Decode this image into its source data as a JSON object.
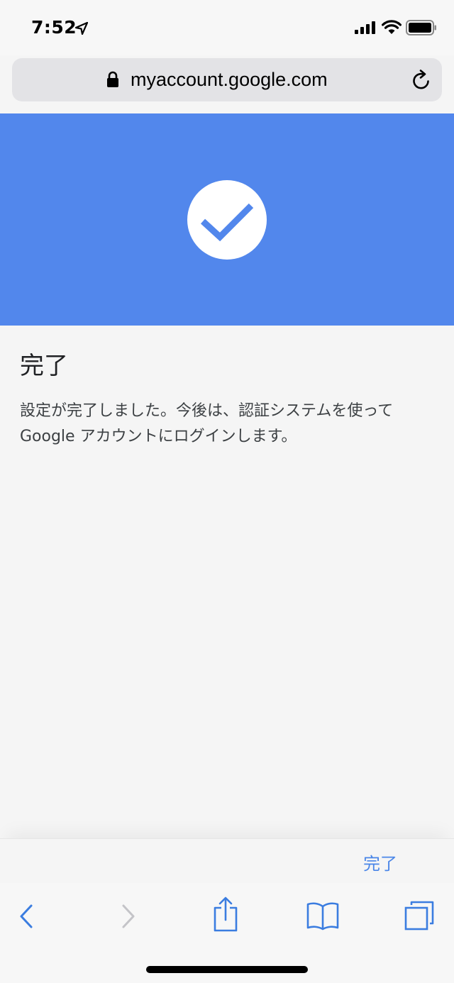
{
  "status_bar": {
    "time": "7:52",
    "icons": [
      "location-arrow-icon",
      "signal-bars-icon",
      "wifi-icon",
      "battery-icon"
    ]
  },
  "browser": {
    "url": "myaccount.google.com",
    "icons": [
      "lock-icon",
      "reload-icon"
    ]
  },
  "hero": {
    "color": "#5287ec",
    "icon": "check-circle-icon"
  },
  "content": {
    "title": "完了",
    "body": "設定が完了しました。今後は、認証システムを使って Google アカウントにログインします。"
  },
  "done_bar": {
    "done_label": "完了",
    "accent": "#4a86e8"
  },
  "toolbar": {
    "icons": [
      "back-icon",
      "forward-icon",
      "share-icon",
      "bookmarks-icon",
      "tabs-icon"
    ]
  }
}
